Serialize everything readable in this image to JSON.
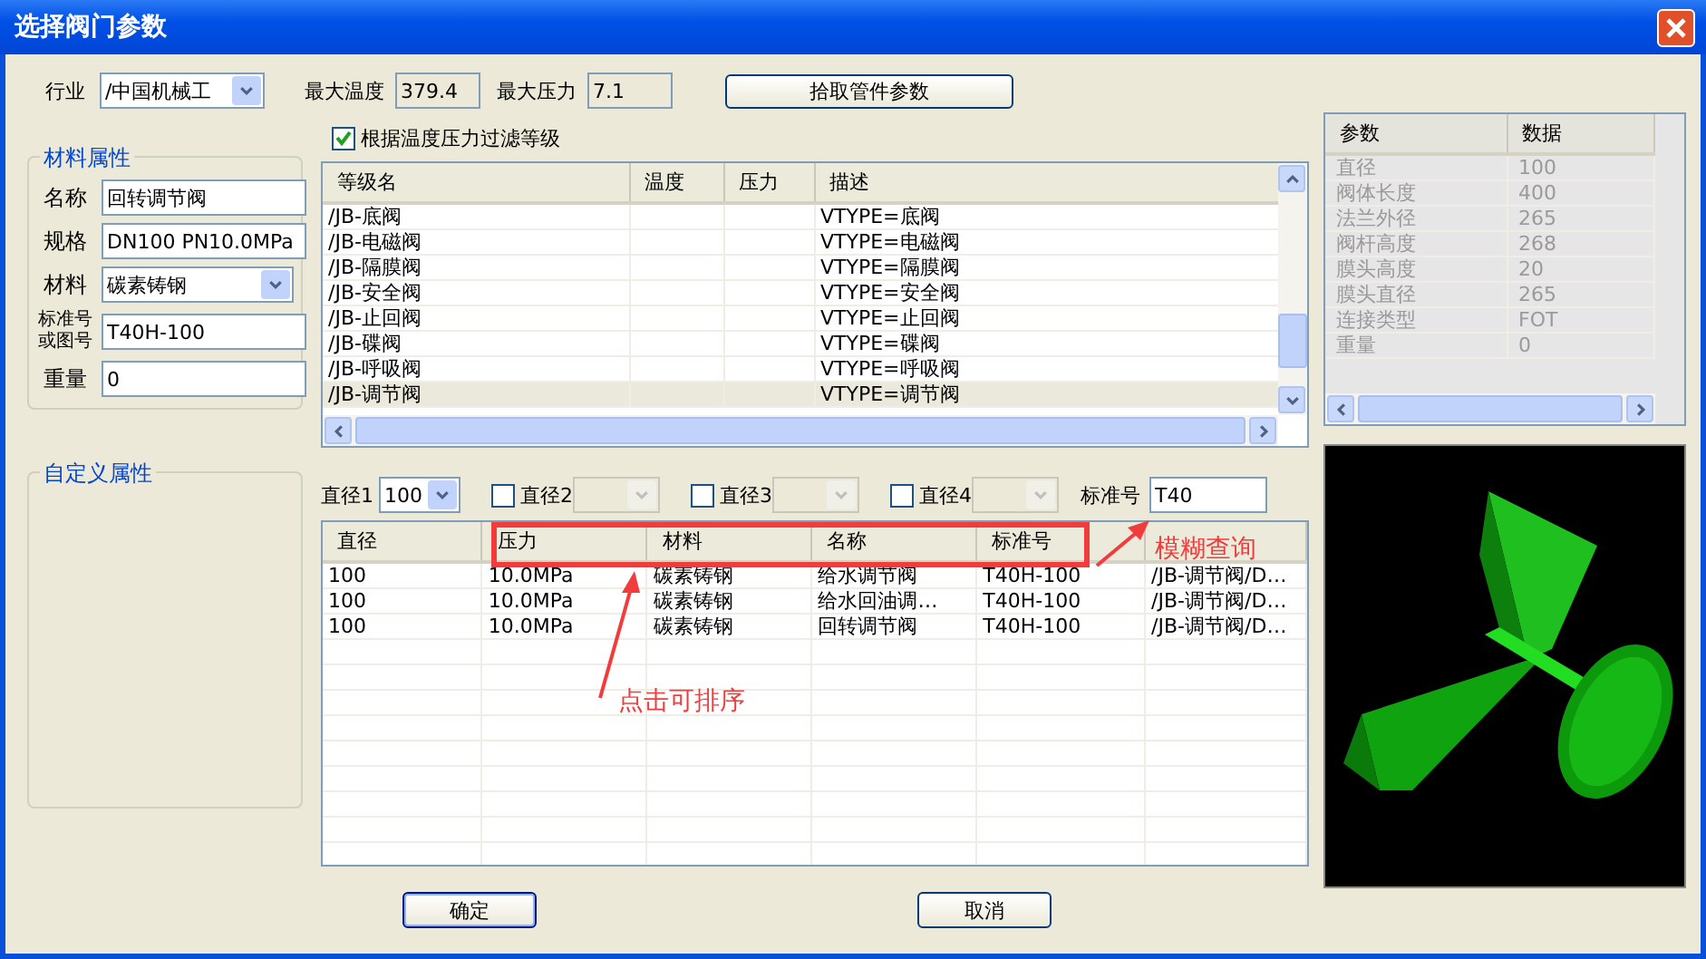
{
  "window": {
    "title": "选择阀门参数"
  },
  "top_bar": {
    "industry_label": "行业",
    "industry_value": "/中国机械工",
    "max_temp_label": "最大温度",
    "max_temp_value": "379.4",
    "max_pressure_label": "最大压力",
    "max_pressure_value": "7.1",
    "pick_button": "拾取管件参数"
  },
  "filter": {
    "label": "根据温度压力过滤等级",
    "checked": true
  },
  "material_group": {
    "title": "材料属性",
    "fields": [
      {
        "label": "名称",
        "value": "回转调节阀",
        "kind": "text"
      },
      {
        "label": "规格",
        "value": "DN100 PN10.0MPa",
        "kind": "text"
      },
      {
        "label": "材料",
        "value": "碳素铸钢",
        "kind": "select"
      },
      {
        "label": "标准号或图号",
        "value": "T40H-100",
        "kind": "text"
      },
      {
        "label": "重量",
        "value": "0",
        "kind": "text"
      }
    ]
  },
  "custom_group": {
    "title": "自定义属性"
  },
  "grade_list": {
    "columns": [
      "等级名",
      "温度",
      "压力",
      "描述"
    ],
    "rows": [
      {
        "name": "/JB-底阀",
        "description": "VTYPE=底阀",
        "selected": false
      },
      {
        "name": "/JB-电磁阀",
        "description": "VTYPE=电磁阀",
        "selected": false
      },
      {
        "name": "/JB-隔膜阀",
        "description": "VTYPE=隔膜阀",
        "selected": false
      },
      {
        "name": "/JB-安全阀",
        "description": "VTYPE=安全阀",
        "selected": false
      },
      {
        "name": "/JB-止回阀",
        "description": "VTYPE=止回阀",
        "selected": false
      },
      {
        "name": "/JB-碟阀",
        "description": "VTYPE=碟阀",
        "selected": false
      },
      {
        "name": "/JB-呼吸阀",
        "description": "VTYPE=呼吸阀",
        "selected": false
      },
      {
        "name": "/JB-调节阀",
        "description": "VTYPE=调节阀",
        "selected": true
      }
    ]
  },
  "param_table": {
    "disabled": true,
    "columns": [
      "参数",
      "数据"
    ],
    "rows": [
      [
        "直径",
        "100"
      ],
      [
        "阀体长度",
        "400"
      ],
      [
        "法兰外径",
        "265"
      ],
      [
        "阀杆高度",
        "268"
      ],
      [
        "膜头高度",
        "20"
      ],
      [
        "膜头直径",
        "265"
      ],
      [
        "连接类型",
        "FOT"
      ],
      [
        "重量",
        "0"
      ]
    ]
  },
  "diameter_filters": [
    {
      "kind": "select",
      "label": "直径1",
      "value": "100"
    },
    {
      "kind": "checkbox",
      "label": "直径2",
      "checked": false
    },
    {
      "kind": "checkbox",
      "label": "直径3",
      "checked": false
    },
    {
      "kind": "checkbox",
      "label": "直径4",
      "checked": false
    }
  ],
  "standard_filter": {
    "label": "标准号",
    "value": "T40"
  },
  "results": {
    "columns": [
      "直径",
      "压力",
      "材料",
      "名称",
      "标准号",
      ""
    ],
    "rows": [
      [
        "100",
        "10.0MPa",
        "碳素铸钢",
        "给水调节阀",
        "T40H-100",
        "/JB-调节阀/D…"
      ],
      [
        "100",
        "10.0MPa",
        "碳素铸钢",
        "给水回油调…",
        "T40H-100",
        "/JB-调节阀/D…"
      ],
      [
        "100",
        "10.0MPa",
        "碳素铸钢",
        "回转调节阀",
        "T40H-100",
        "/JB-调节阀/D…"
      ]
    ]
  },
  "annotations": [
    {
      "text": "模糊查询"
    },
    {
      "text": "点击可排序"
    }
  ],
  "buttons": [
    {
      "label": "确定",
      "default": true
    },
    {
      "label": "取消",
      "default": false
    }
  ]
}
